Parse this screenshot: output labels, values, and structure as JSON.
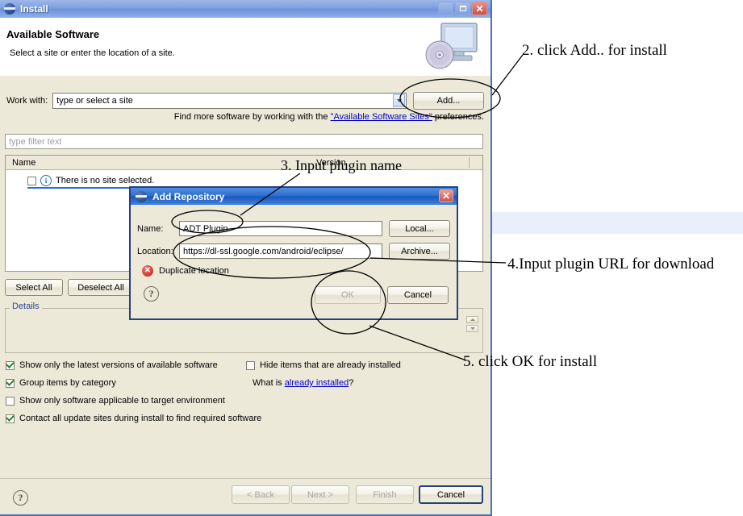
{
  "install_window": {
    "title": "Install",
    "icon": "eclipse-icon",
    "window_controls": {
      "minimize": "_",
      "maximize": "□",
      "close": "✕"
    },
    "header": {
      "title": "Available Software",
      "subtitle": "Select a site or enter the location of a site.",
      "icon": "monitor-cd-icon"
    },
    "work_with": {
      "label": "Work with:",
      "value": "type or select a site",
      "add_button": "Add..."
    },
    "hint": {
      "prefix": "Find more software by working with the ",
      "link": "\"Available Software Sites\"",
      "suffix": " preferences."
    },
    "filter_placeholder": "type filter text",
    "tree": {
      "columns": [
        "Name",
        "Version"
      ],
      "rows": [
        {
          "label": "There is no site selected.",
          "checked": false,
          "icon": "info-icon"
        }
      ]
    },
    "buttons": {
      "select_all": "Select All",
      "deselect_all": "Deselect All"
    },
    "details": {
      "legend": "Details",
      "text": ""
    },
    "options": [
      {
        "label": "Show only the latest versions of available software",
        "checked": true
      },
      {
        "label": "Group items by category",
        "checked": true
      },
      {
        "label": "Show only software applicable to target environment",
        "checked": false
      },
      {
        "label": "Contact all update sites during install to find required software",
        "checked": true
      },
      {
        "label": "Hide items that are already installed",
        "checked": false
      }
    ],
    "already_installed": {
      "prefix": "What is ",
      "link": "already installed",
      "suffix": "?"
    },
    "footer": {
      "help": "?",
      "back": "< Back",
      "next": "Next >",
      "finish": "Finish",
      "cancel": "Cancel"
    }
  },
  "add_repository_dialog": {
    "title": "Add Repository",
    "icon": "eclipse-icon",
    "close": "✕",
    "name": {
      "label": "Name:",
      "value": "ADT Plugin",
      "button": "Local..."
    },
    "location": {
      "label": "Location:",
      "value": "https://dl-ssl.google.com/android/eclipse/",
      "button": "Archive..."
    },
    "error": {
      "icon": "error-icon",
      "text": "Duplicate location"
    },
    "help": "?",
    "ok": "OK",
    "cancel": "Cancel"
  },
  "annotations": [
    {
      "id": "anno2",
      "text": "2. click Add.. for install"
    },
    {
      "id": "anno3",
      "text": "3. Input plugin name"
    },
    {
      "id": "anno4",
      "text": "4.Input plugin URL for download"
    },
    {
      "id": "anno5",
      "text": "5. click OK for install"
    }
  ],
  "colors": {
    "window_chrome": "#ece9d8",
    "install_title_blue": "#7e9fe0",
    "repo_title_blue": "#2f6fd0",
    "dialog_border": "#27417e",
    "link": "#0000cc",
    "error_red": "#c01a12",
    "selection_blue": "#2a6ed6"
  }
}
